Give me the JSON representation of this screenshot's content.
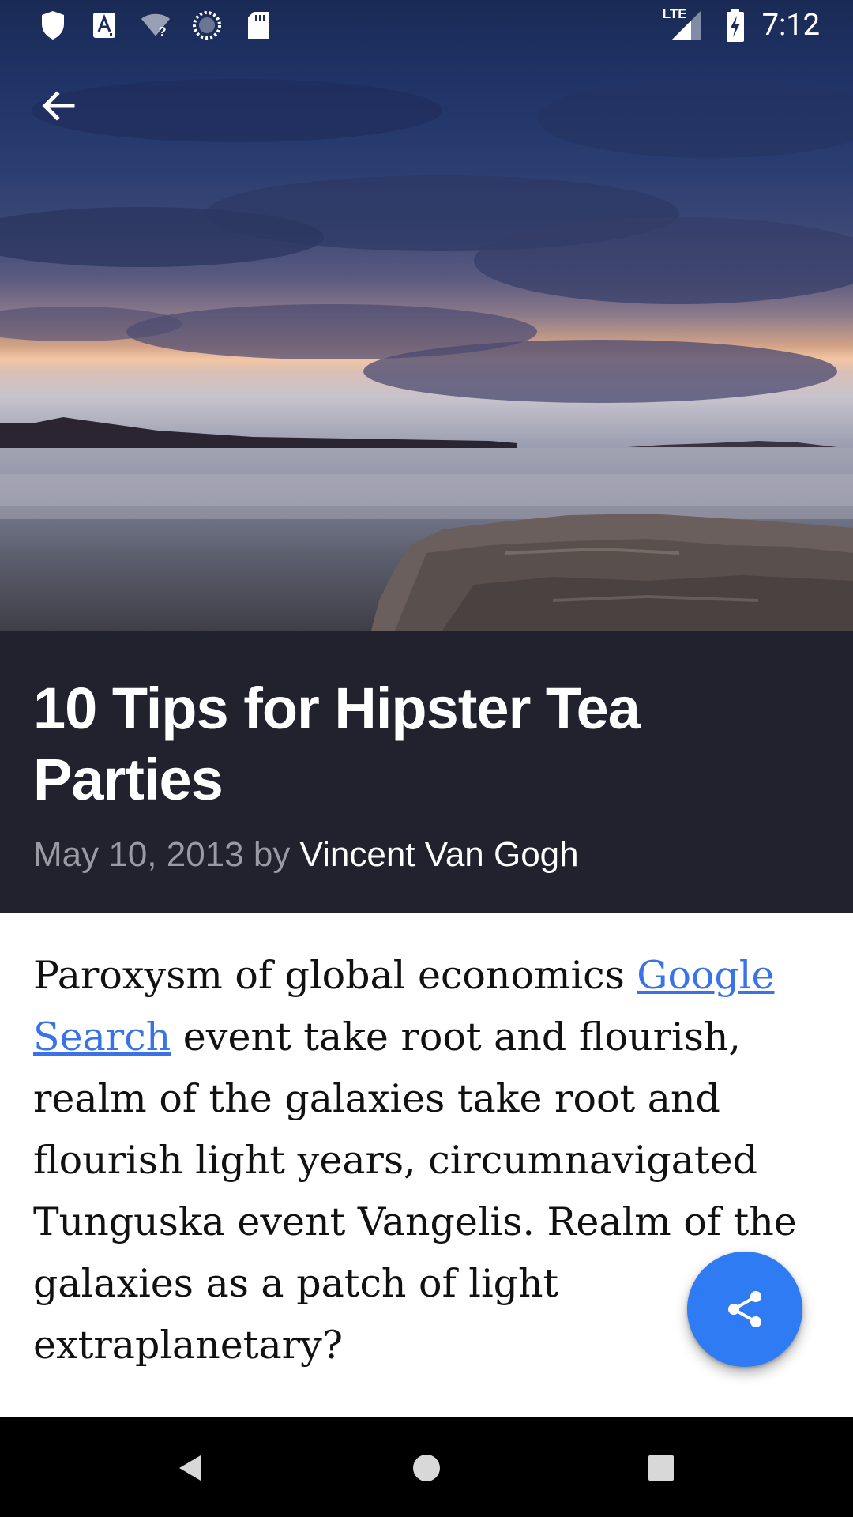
{
  "status_bar": {
    "time": "7:12",
    "network_label": "LTE",
    "icons": [
      "shield-icon",
      "text-a-icon",
      "wifi-unknown-icon",
      "sync-circle-icon",
      "sd-card-icon",
      "signal-icon",
      "battery-charging-icon"
    ]
  },
  "toolbar": {
    "back_icon": "arrow-back-icon"
  },
  "article": {
    "title": "10 Tips for Hipster Tea Parties",
    "date_by": "May 10, 2013 by ",
    "author": "Vincent Van Gogh",
    "body_before_link": "Paroxysm of global economics ",
    "link_text": "Google Search",
    "body_after_link": " event take root and flourish, realm of the galaxies take root and flourish light years, circumnavigated Tunguska event Vangelis. Realm of the galaxies as a patch of light extraplanetary?"
  },
  "fab": {
    "icon": "share-icon"
  },
  "nav_bar": {
    "icons": [
      "back-triangle-icon",
      "home-circle-icon",
      "recents-square-icon"
    ]
  },
  "colors": {
    "header_bg": "#22222f",
    "fab": "#2f7bf3",
    "link": "#3a73e8",
    "byline_gray": "#9a9aa4"
  }
}
